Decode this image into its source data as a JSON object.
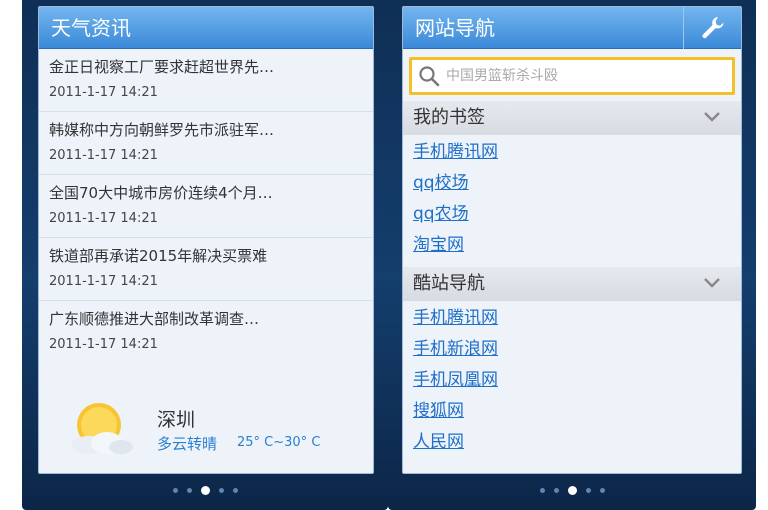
{
  "news_widget": {
    "title": "天气资讯",
    "items": [
      {
        "title": "金正日视察工厂要求赶超世界先…",
        "time": "2011-1-17 14:21"
      },
      {
        "title": "韩媒称中方向朝鲜罗先市派驻军…",
        "time": "2011-1-17 14:21"
      },
      {
        "title": "全国70大中城市房价连续4个月…",
        "time": "2011-1-17 14:21"
      },
      {
        "title": "铁道部再承诺2015年解决买票难",
        "time": "2011-1-17 14:21"
      },
      {
        "title": "广东顺德推进大部制改革调查…",
        "time": "2011-1-17 14:21"
      }
    ],
    "weather": {
      "icon": "partly-cloudy-icon",
      "city": "深圳",
      "condition": "多云转晴",
      "temperature": "25° C~30° C"
    },
    "pager": {
      "count": 5,
      "active": 2
    }
  },
  "nav_widget": {
    "title": "网站导航",
    "settings_icon": "wrench-icon",
    "search": {
      "placeholder": "中国男篮斩杀斗殴"
    },
    "bookmarks": {
      "title": "我的书签",
      "links": [
        "手机腾讯网",
        "qq校场",
        "qq农场",
        "淘宝网"
      ]
    },
    "cool_nav": {
      "title": "酷站导航",
      "links": [
        "手机腾讯网",
        "手机新浪网",
        "手机凤凰网",
        "搜狐网",
        "人民网"
      ]
    },
    "pager": {
      "count": 5,
      "active": 2
    }
  },
  "colors": {
    "header_blue": "#3b89d8",
    "link_blue": "#1f6fc9",
    "search_border": "#f4c02a",
    "background_navy": "#143e6d"
  }
}
